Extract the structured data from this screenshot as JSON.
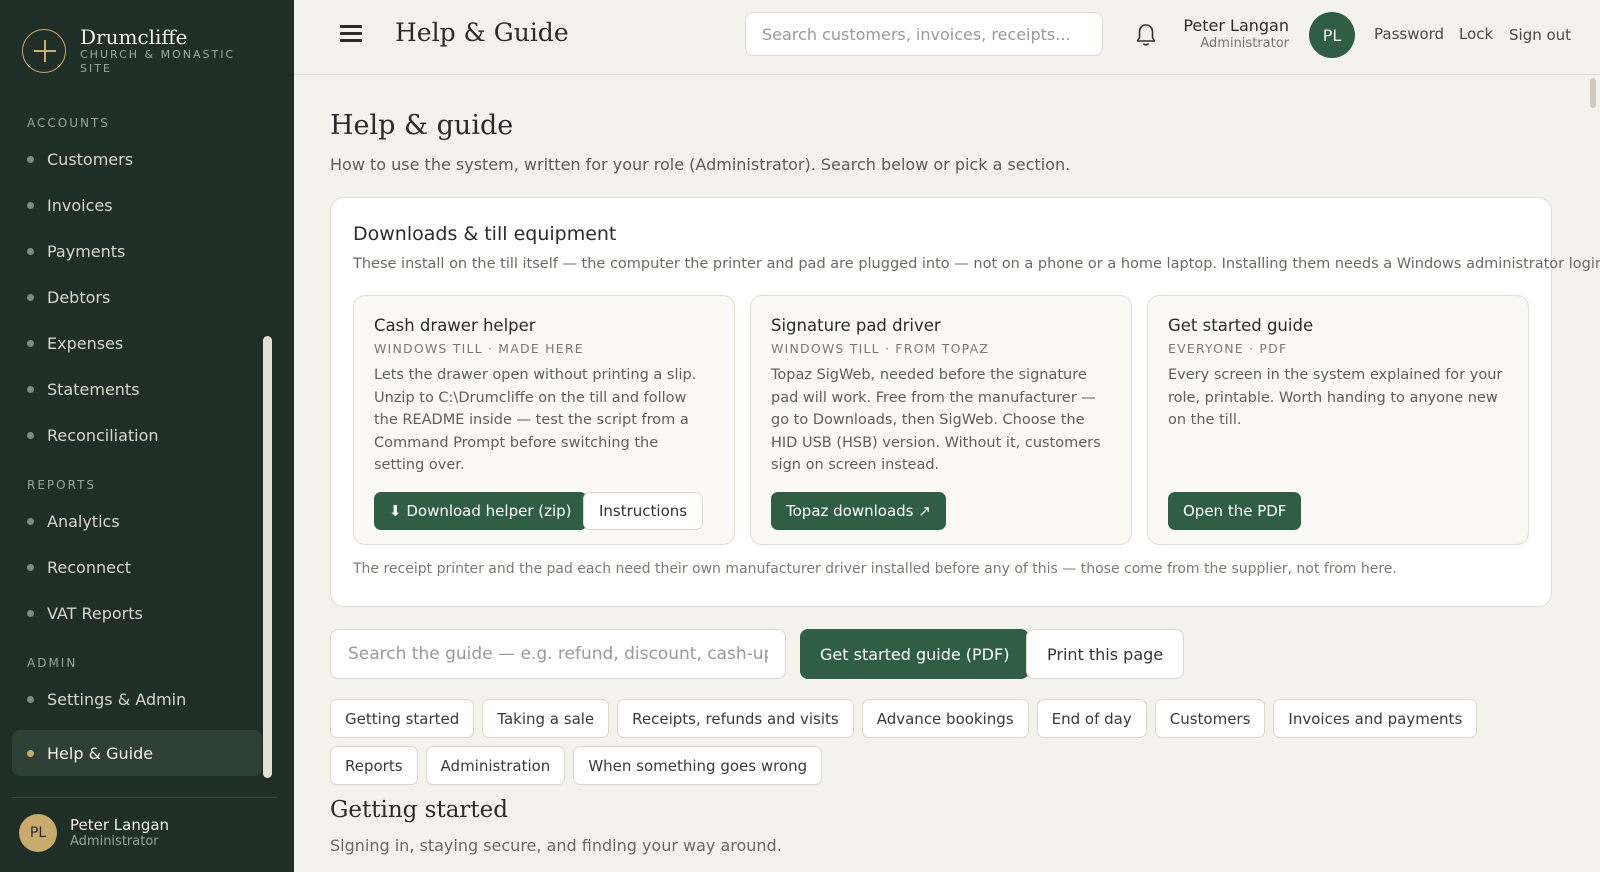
{
  "brand": {
    "name": "Drumcliffe",
    "subtitle": "CHURCH & MONASTIC SITE"
  },
  "sidebar": {
    "sections": [
      {
        "label": "ACCOUNTS",
        "items": [
          "Customers",
          "Invoices",
          "Payments",
          "Debtors",
          "Expenses",
          "Statements",
          "Reconciliation"
        ]
      },
      {
        "label": "REPORTS",
        "items": [
          "Analytics",
          "Reconnect",
          "VAT Reports"
        ]
      },
      {
        "label": "ADMIN",
        "items": [
          "Settings & Admin",
          "Help & Guide"
        ]
      }
    ],
    "active_item": "Help & Guide",
    "user": {
      "initials": "PL",
      "name": "Peter Langan",
      "role": "Administrator"
    }
  },
  "header": {
    "title": "Help & Guide",
    "search_placeholder": "Search customers, invoices, receipts...",
    "user": {
      "name": "Peter Langan",
      "role": "Administrator",
      "initials": "PL"
    },
    "links": [
      "Password",
      "Lock",
      "Sign out"
    ]
  },
  "page": {
    "title": "Help & guide",
    "subtitle": "How to use the system, written for your role (Administrator). Search below or pick a section."
  },
  "downloads": {
    "title": "Downloads & till equipment",
    "description": "These install on the till itself — the computer the printer and pad are plugged into — not on a phone or a home laptop. Installing them needs a Windows administrator login.",
    "cards": [
      {
        "title": "Cash drawer helper",
        "tag": "WINDOWS TILL · MADE HERE",
        "body": "Lets the drawer open without printing a slip. Unzip to C:\\Drumcliffe on the till and follow the README inside — test the script from a Command Prompt before switching the setting over.",
        "primary": "⬇ Download helper (zip)",
        "secondary": "Instructions"
      },
      {
        "title": "Signature pad driver",
        "tag": "WINDOWS TILL · FROM TOPAZ",
        "body": "Topaz SigWeb, needed before the signature pad will work. Free from the manufacturer — go to Downloads, then SigWeb. Choose the HID USB (HSB) version. Without it, customers sign on screen instead.",
        "primary": "Topaz downloads ↗"
      },
      {
        "title": "Get started guide",
        "tag": "EVERYONE · PDF",
        "body": "Every screen in the system explained for your role, printable. Worth handing to anyone new on the till.",
        "primary": "Open the PDF"
      }
    ],
    "footnote": "The receipt printer and the pad each need their own manufacturer driver installed before any of this — those come from the supplier, not from here."
  },
  "guide": {
    "search_placeholder": "Search the guide — e.g. refund, discount, cash-up...",
    "pdf_button": "Get started guide (PDF)",
    "print_button": "Print this page",
    "topics": [
      "Getting started",
      "Taking a sale",
      "Receipts, refunds and visits",
      "Advance bookings",
      "End of day",
      "Customers",
      "Invoices and payments",
      "Reports",
      "Administration",
      "When something goes wrong"
    ]
  },
  "section": {
    "title": "Getting started",
    "subtitle": "Signing in, staying secure, and finding your way around."
  },
  "colors": {
    "sidebar": "#1f2e26",
    "accent_green": "#2f5e45",
    "gold": "#c9ab6b",
    "background": "#f4f2ec"
  }
}
